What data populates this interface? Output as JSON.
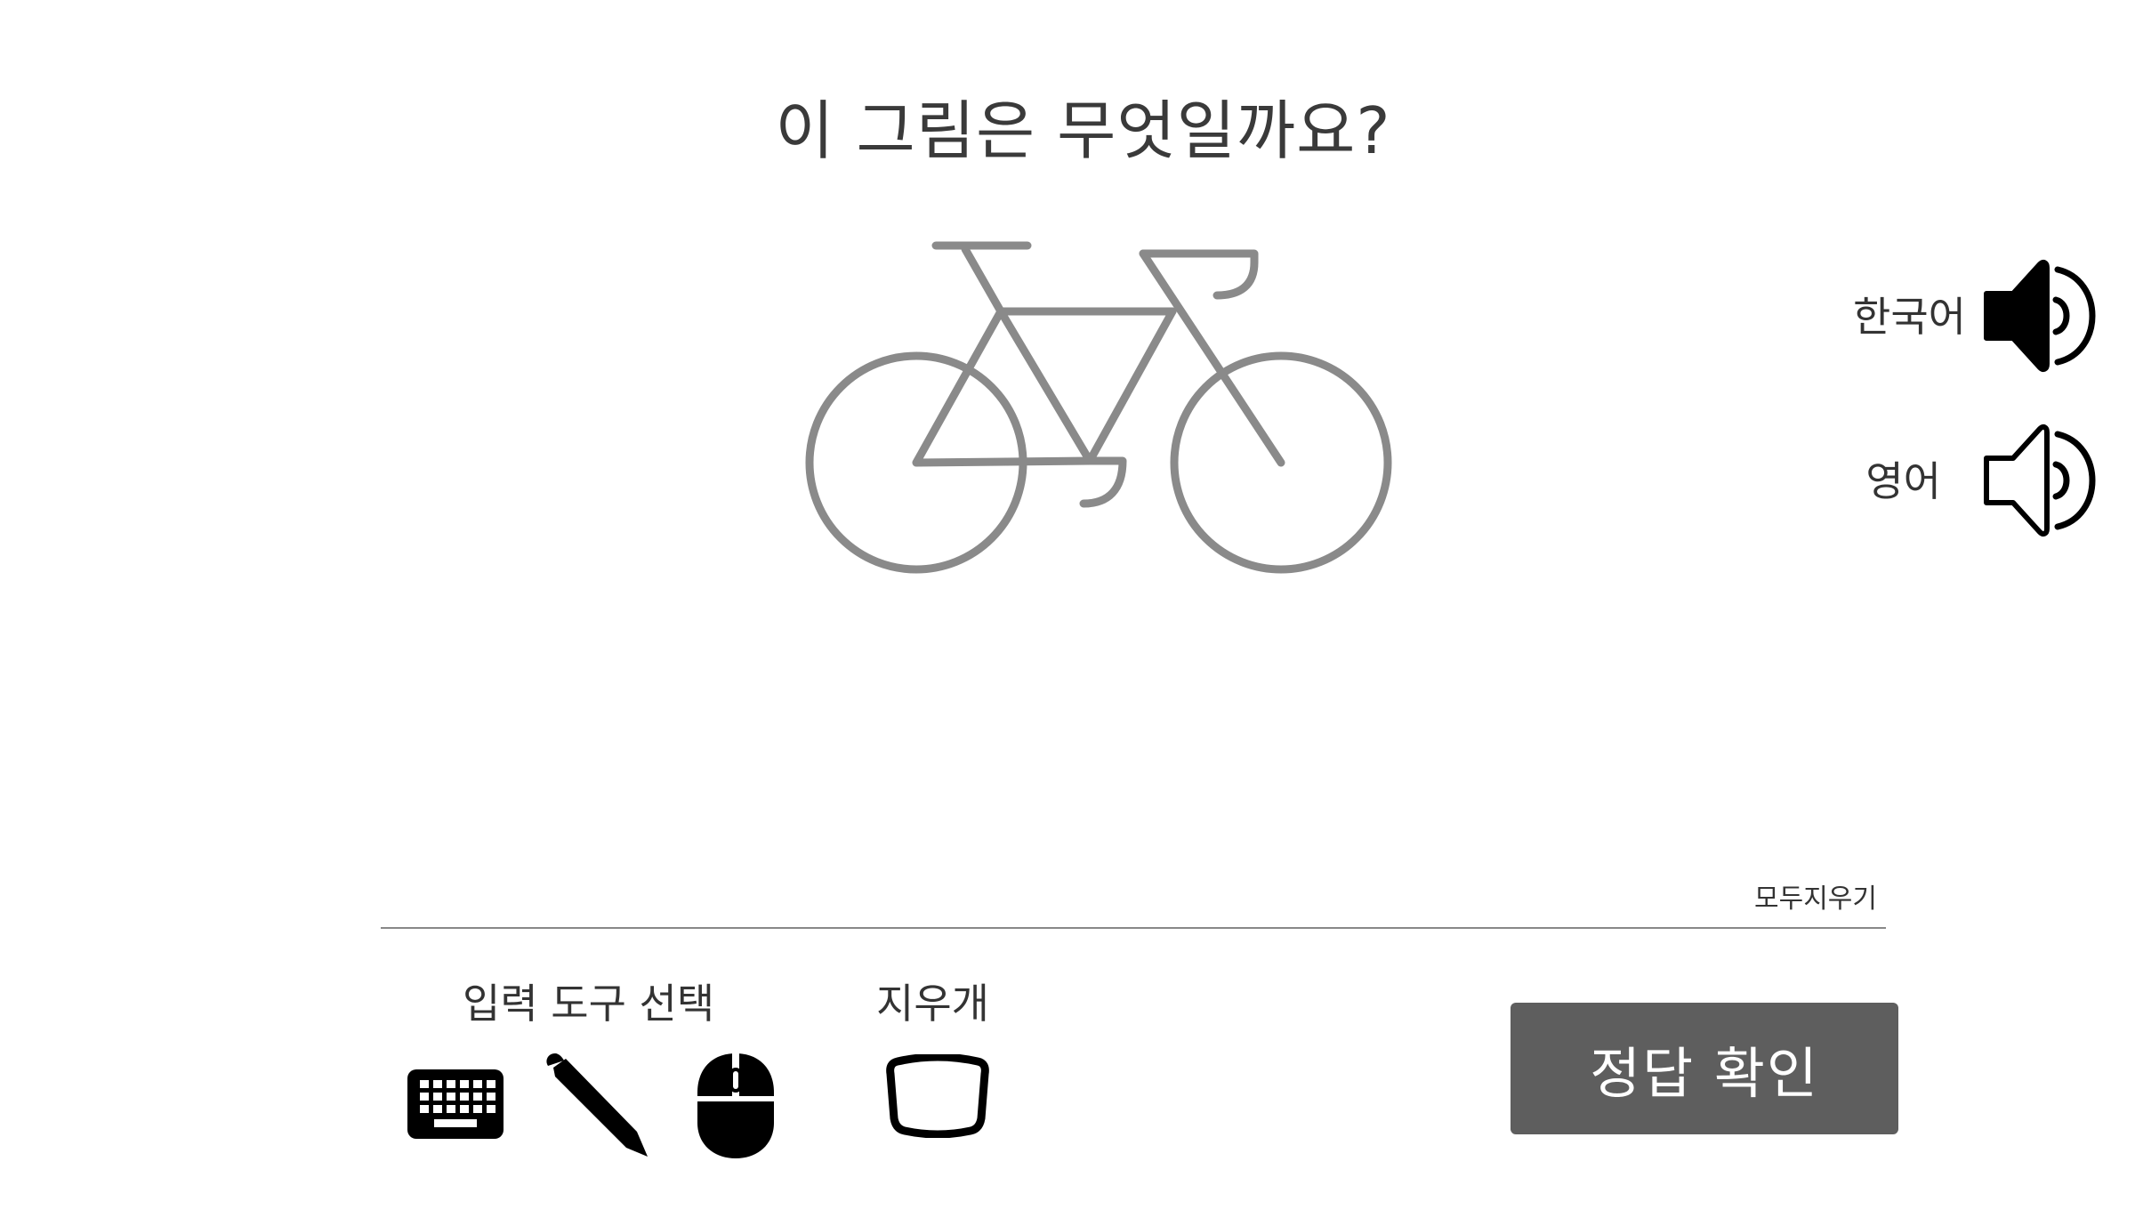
{
  "question": {
    "title": "이 그림은 무엇일까요?",
    "picture_icon": "bicycle-icon"
  },
  "audio": {
    "korean_label": "한국어",
    "english_label": "영어",
    "korean_icon": "speaker-filled-icon",
    "english_icon": "speaker-outline-icon"
  },
  "answer_area": {
    "clear_all_label": "모두지우기"
  },
  "tools": {
    "input_tool_label": "입력 도구 선택",
    "eraser_label": "지우개",
    "icons": [
      "keyboard-icon",
      "pen-icon",
      "mouse-icon",
      "eraser-icon"
    ]
  },
  "submit": {
    "label": "정답 확인"
  },
  "colors": {
    "picture_stroke": "#8a8a8a",
    "submit_bg": "#5e5e5e",
    "submit_text": "#ffffff",
    "text": "#333333",
    "divider": "#888888"
  }
}
